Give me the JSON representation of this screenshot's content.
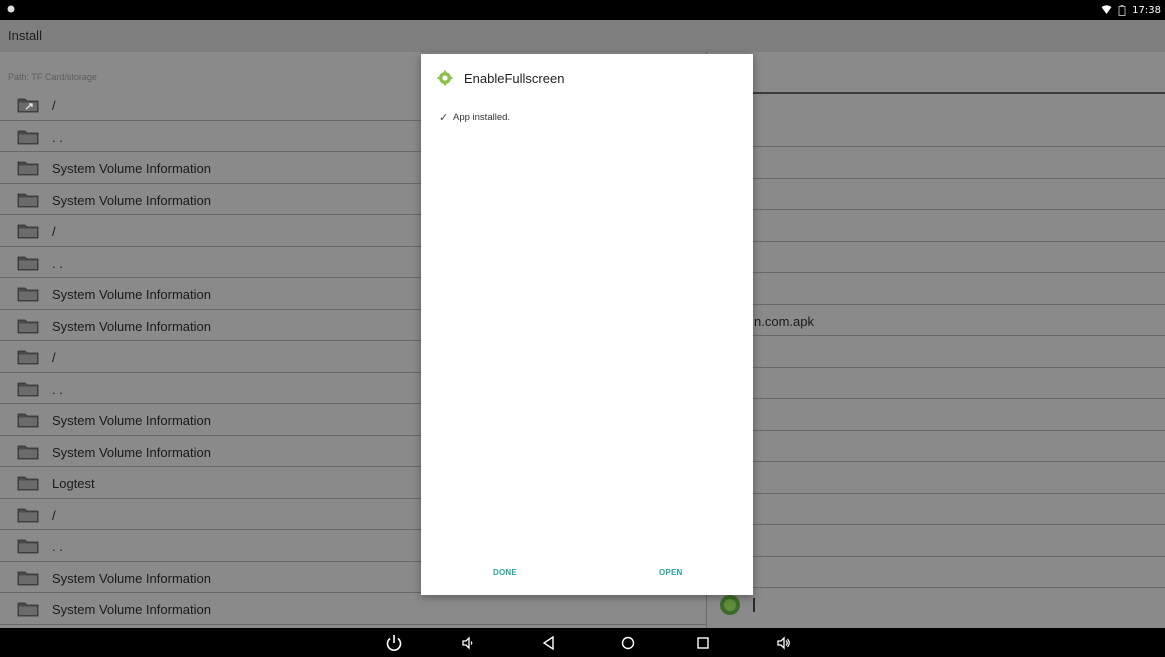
{
  "status_bar": {
    "time": "17:38"
  },
  "action_bar": {
    "title": "Install"
  },
  "file_browser": {
    "path_label": "Path:  TF Card/storage",
    "rows": [
      {
        "label": "/",
        "icon": "folder-up-icon"
      },
      {
        "label": ". .",
        "icon": "folder-icon"
      },
      {
        "label": "System Volume Information",
        "icon": "folder-icon"
      },
      {
        "label": "System Volume Information",
        "icon": "folder-icon"
      },
      {
        "label": "/",
        "icon": "folder-icon"
      },
      {
        "label": ". .",
        "icon": "folder-icon"
      },
      {
        "label": "System Volume Information",
        "icon": "folder-icon"
      },
      {
        "label": "System Volume Information",
        "icon": "folder-icon"
      },
      {
        "label": "/",
        "icon": "folder-icon"
      },
      {
        "label": ". .",
        "icon": "folder-icon"
      },
      {
        "label": "System Volume Information",
        "icon": "folder-icon"
      },
      {
        "label": "System Volume Information",
        "icon": "folder-icon"
      },
      {
        "label": "Logtest",
        "icon": "folder-icon"
      },
      {
        "label": "/",
        "icon": "folder-icon"
      },
      {
        "label": ". .",
        "icon": "folder-icon"
      },
      {
        "label": "System Volume Information",
        "icon": "folder-icon"
      },
      {
        "label": "System Volume Information",
        "icon": "folder-icon"
      }
    ]
  },
  "right_pane": {
    "apk_fragment": "n.com.apk"
  },
  "dialog": {
    "app_name": "EnableFullscreen",
    "check_mark": "✓",
    "message": "App installed.",
    "done_label": "DONE",
    "open_label": "OPEN",
    "accent_color": "#26a69a"
  },
  "colors": {
    "dim_background": "#8a8a8a",
    "dialog_background": "#ffffff",
    "bars": "#000000"
  }
}
